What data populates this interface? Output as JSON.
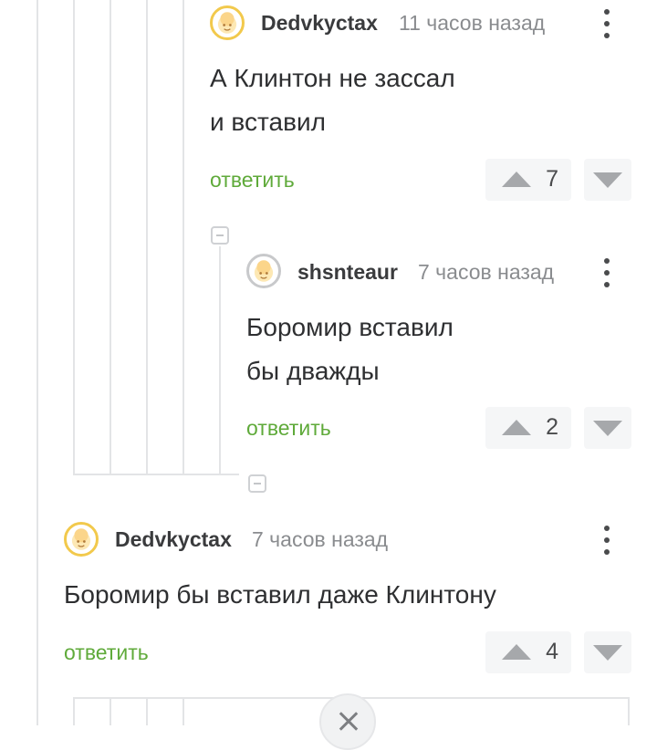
{
  "comments": [
    {
      "username": "Dedvkyctax",
      "time": "11 часов назад",
      "text_lines": [
        "А Клинтон не зассал",
        "и вставил"
      ],
      "reply_label": "ответить",
      "rating": "7"
    },
    {
      "username": "shsnteaur",
      "time": "7 часов назад",
      "text_lines": [
        "Боромир вставил",
        "бы дважды"
      ],
      "reply_label": "ответить",
      "rating": "2"
    },
    {
      "username": "Dedvkyctax",
      "time": "7 часов назад",
      "text_lines": [
        "Боромир бы вставил даже Клинтону"
      ],
      "reply_label": "ответить",
      "rating": "4"
    }
  ],
  "icons": {
    "avatar": "default-avatar-icon",
    "more": "more-vertical-icon",
    "upvote": "triangle-up-icon",
    "downvote": "triangle-down-icon",
    "collapse": "collapse-minus-icon",
    "close": "close-icon"
  },
  "colors": {
    "reply": "#5faa3a",
    "thread_line": "#e3e4e6",
    "avatar_ring": "#f2c94c"
  }
}
